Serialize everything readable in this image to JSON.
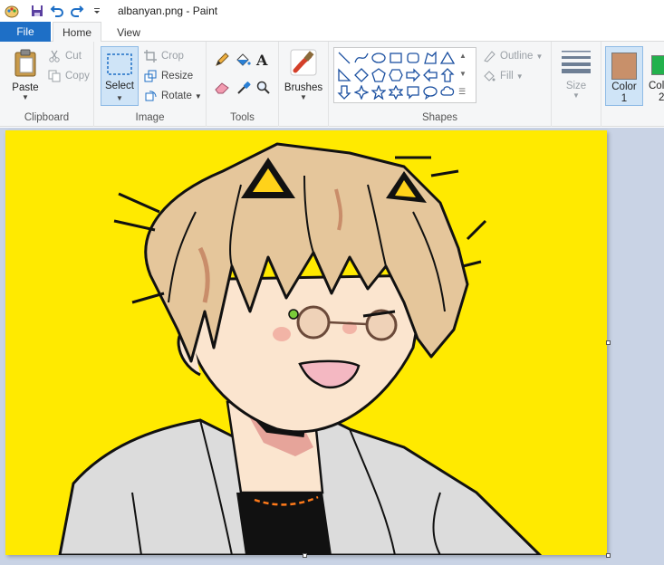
{
  "window": {
    "title": "albanyan.png - Paint"
  },
  "tabs": {
    "file": "File",
    "home": "Home",
    "view": "View"
  },
  "clipboard": {
    "paste": "Paste",
    "cut": "Cut",
    "copy": "Copy",
    "label": "Clipboard"
  },
  "image": {
    "select": "Select",
    "crop": "Crop",
    "resize": "Resize",
    "rotate": "Rotate",
    "label": "Image"
  },
  "tools": {
    "label": "Tools"
  },
  "brushes": {
    "label": "Brushes"
  },
  "shapes": {
    "outline": "Outline",
    "fill": "Fill",
    "label": "Shapes"
  },
  "size": {
    "label": "Size"
  },
  "colors": {
    "color1_label": "Color",
    "color1_num": "1",
    "color2_label": "Col",
    "color2_num": "2",
    "color1_value": "#c8906a",
    "color2_value": "#22b14c"
  },
  "canvas": {
    "background": "#ffea00"
  }
}
